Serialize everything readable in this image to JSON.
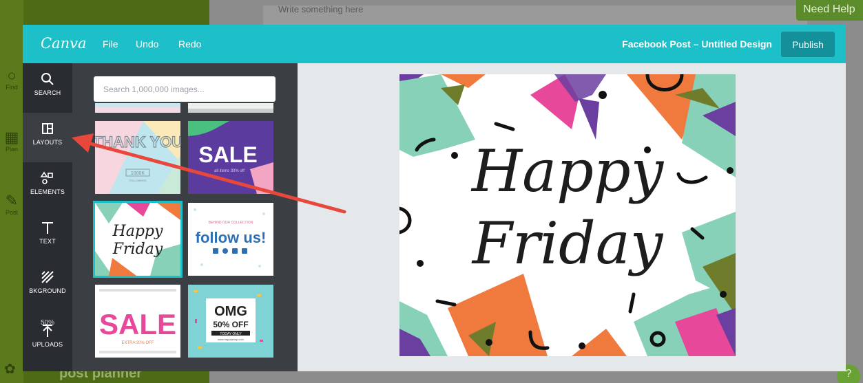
{
  "background": {
    "compose_placeholder": "Write something here",
    "need_help": "Need Help",
    "nav": [
      {
        "label": "Find",
        "icon": "search-icon"
      },
      {
        "label": "Plan",
        "icon": "calendar-icon"
      },
      {
        "label": "Post",
        "icon": "pencil-icon"
      }
    ],
    "logo": "post planner",
    "help_icon": "?"
  },
  "canva": {
    "logo": "Canva",
    "menu": {
      "file": "File",
      "undo": "Undo",
      "redo": "Redo"
    },
    "doc_title": "Facebook Post – Untitled Design",
    "publish": "Publish",
    "sidebar": [
      {
        "label": "SEARCH",
        "icon": "search-icon"
      },
      {
        "label": "LAYOUTS",
        "icon": "layout-icon",
        "active": true
      },
      {
        "label": "ELEMENTS",
        "icon": "shapes-icon"
      },
      {
        "label": "TEXT",
        "icon": "text-icon"
      },
      {
        "label": "BKGROUND",
        "icon": "hatch-icon"
      },
      {
        "label": "UPLOADS",
        "icon": "upload-arrow-icon"
      }
    ],
    "search_placeholder": "Search 1,000,000 images...",
    "overlay_text": "50%",
    "thumbnails": [
      {
        "name": "thank-you",
        "text": "THANK YOU",
        "sub": "1000K",
        "caption": "FOLLOWERS"
      },
      {
        "name": "sale-purple",
        "text": "SALE",
        "sub": "all items 30% off"
      },
      {
        "name": "happy-friday",
        "text1": "Happy",
        "text2": "Friday",
        "selected": true
      },
      {
        "name": "follow-us",
        "pre": "BEHIND OUR COLLECTION",
        "text": "follow us!"
      },
      {
        "name": "sale-colorful",
        "text": "SALE",
        "sub": "EXTRA 20% OFF"
      },
      {
        "name": "omg",
        "text1": "OMG",
        "text2": "50% OFF",
        "sub": "TODAY ONLY",
        "url": "www.happyshop.com"
      }
    ],
    "design": {
      "line1": "Happy",
      "line2": "Friday"
    }
  },
  "colors": {
    "teal": "#1dbfc9",
    "mint": "#86d1b8",
    "orange": "#f07a3e",
    "pink": "#e8489a",
    "purple": "#6b3fa0",
    "olive": "#6e7c2c",
    "arrow": "#e8473c"
  }
}
